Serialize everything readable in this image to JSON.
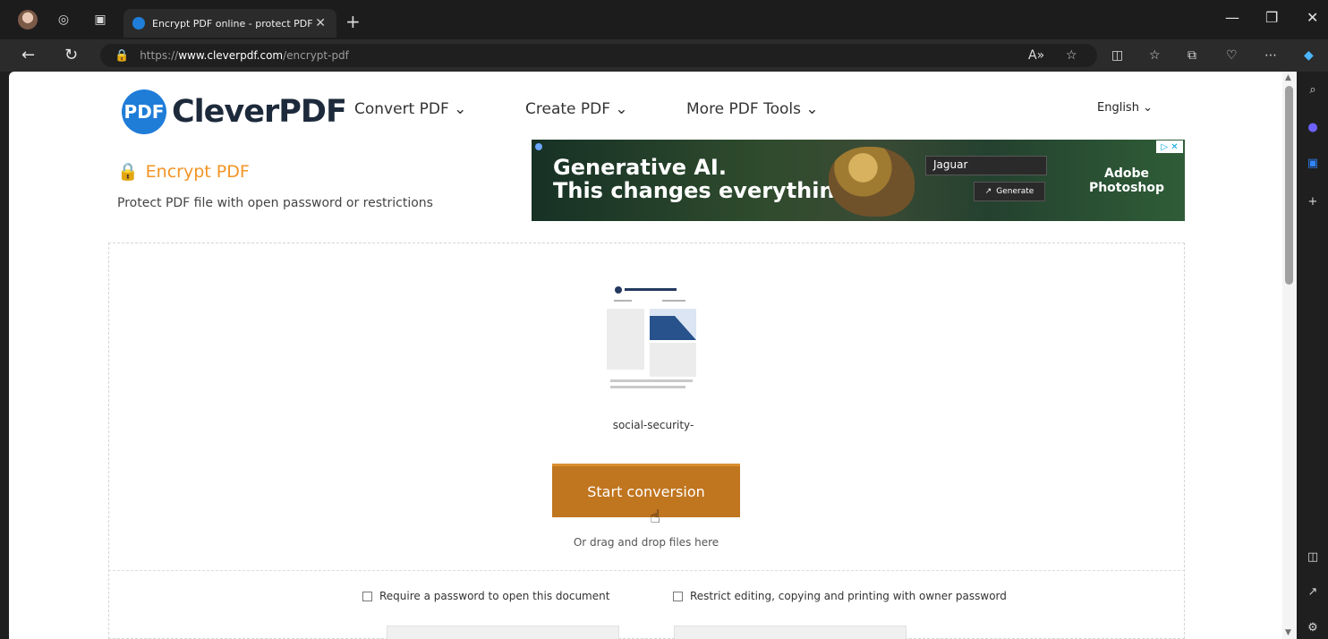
{
  "browser": {
    "tab_title": "Encrypt PDF online - protect PDF",
    "url_prefix": "https://",
    "url_domain": "www.cleverpdf.com",
    "url_path": "/encrypt-pdf",
    "window_min": "—",
    "window_restore": "❐",
    "window_close": "✕"
  },
  "site": {
    "logo_text": "CleverPDF",
    "logo_mark": "PDF",
    "menu": [
      "Convert PDF ⌄",
      "Create PDF ⌄",
      "More PDF Tools ⌄"
    ],
    "language": "English ⌄"
  },
  "tool": {
    "title": "Encrypt PDF",
    "subtitle": "Protect PDF file with open password or restrictions"
  },
  "ad": {
    "headline": "Generative AI.\nThis changes everything.",
    "input_value": "Jaguar",
    "button": "Generate",
    "brand": "Adobe\nPhotoshop",
    "badge": "▷ ✕"
  },
  "dropzone": {
    "file_name": "social-security-",
    "start_button": "Start conversion",
    "drag_hint": "Or drag and drop files here"
  },
  "options": {
    "require_password": "Require a password to open this document",
    "restrict_editing": "Restrict editing, copying and printing with owner password"
  },
  "colors": {
    "accent_orange": "#f29425",
    "start_button": "#c0751f",
    "logo_blue": "#1f7dd8"
  },
  "icons": [
    "profile-avatar",
    "workspaces-icon",
    "tabs-icon",
    "lock-icon",
    "read-aloud-icon",
    "favorite-icon",
    "split-screen-icon",
    "favorites-icon",
    "collections-icon",
    "browser-essentials-icon",
    "more-icon",
    "copilot-icon",
    "search-icon",
    "outlook-icon",
    "office-icon",
    "add-icon",
    "sidebar-icon",
    "open-in-new-icon",
    "settings-icon"
  ]
}
